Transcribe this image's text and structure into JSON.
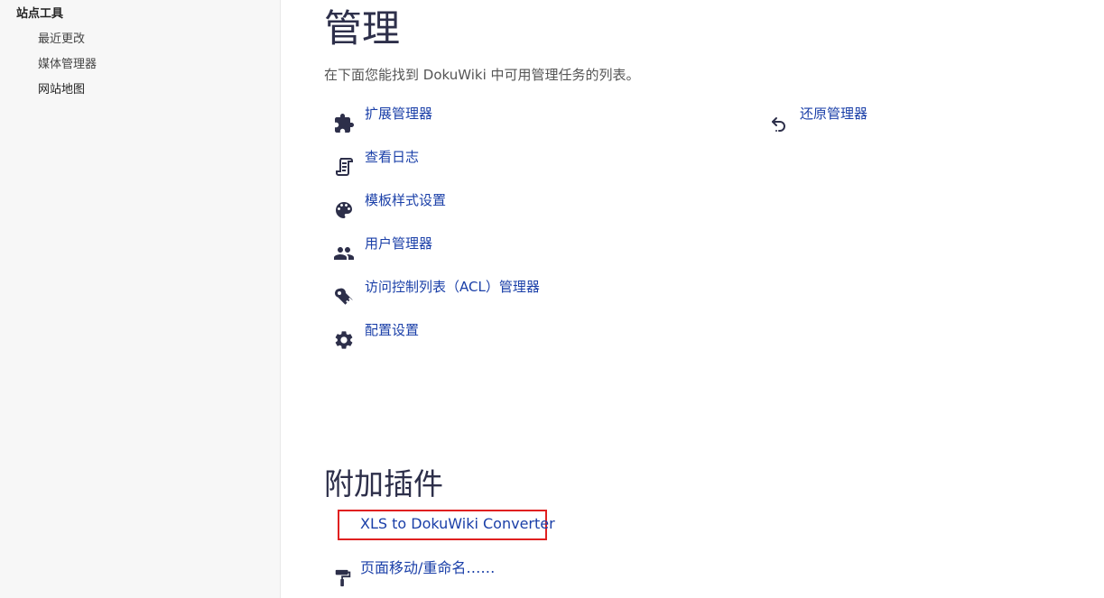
{
  "sidebar": {
    "title": "站点工具",
    "items": [
      {
        "label": "最近更改"
      },
      {
        "label": "媒体管理器"
      },
      {
        "label": "网站地图"
      }
    ]
  },
  "main": {
    "title": "管理",
    "intro": "在下面您能找到 DokuWiki 中可用管理任务的列表。",
    "admin_items": [
      {
        "label": "扩展管理器",
        "icon": "puzzle-icon"
      },
      {
        "label": "查看日志",
        "icon": "scroll-icon"
      },
      {
        "label": "模板样式设置",
        "icon": "palette-icon"
      },
      {
        "label": "用户管理器",
        "icon": "users-icon"
      },
      {
        "label": "访问控制列表（ACL）管理器",
        "icon": "key-icon"
      },
      {
        "label": "配置设置",
        "icon": "gear-icon"
      },
      {
        "label": "还原管理器",
        "icon": "undo-icon"
      }
    ],
    "plugins_title": "附加插件",
    "plugins": [
      {
        "label": "XLS to DokuWiki Converter"
      },
      {
        "label": "页面移动/重命名……",
        "icon": "paint-roller-icon"
      }
    ]
  },
  "colors": {
    "link": "#1a3fa8",
    "heading": "#2d2f4a",
    "icon": "#2d2f4a",
    "highlight": "#e02020"
  }
}
